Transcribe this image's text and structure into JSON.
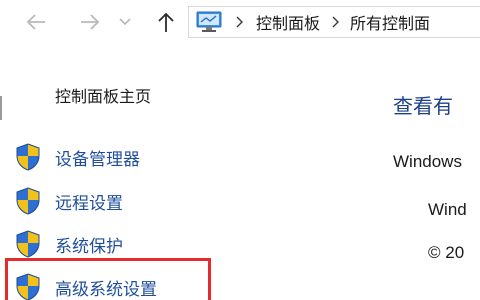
{
  "navigation": {
    "back_icon": "arrow-left-icon",
    "forward_icon": "arrow-right-icon",
    "history_icon": "chevron-down-icon",
    "up_icon": "arrow-up-icon"
  },
  "address_bar": {
    "icon": "control-panel-icon",
    "breadcrumbs": [
      "控制面板",
      "所有控制面"
    ]
  },
  "sidebar": {
    "home_label": "控制面板主页",
    "items": [
      {
        "label": "设备管理器",
        "icon": "uac-shield-icon"
      },
      {
        "label": "远程设置",
        "icon": "uac-shield-icon"
      },
      {
        "label": "系统保护",
        "icon": "uac-shield-icon"
      },
      {
        "label": "高级系统设置",
        "icon": "uac-shield-icon"
      }
    ]
  },
  "main": {
    "heading": "查看有",
    "lines": [
      "Windows",
      "Wind",
      "© 20"
    ]
  },
  "colors": {
    "link": "#1f4f9c",
    "heading": "#1e3f8a",
    "highlight": "#e52b2b",
    "shield_blue": "#2f6fd1",
    "shield_yellow": "#f2c21a"
  }
}
